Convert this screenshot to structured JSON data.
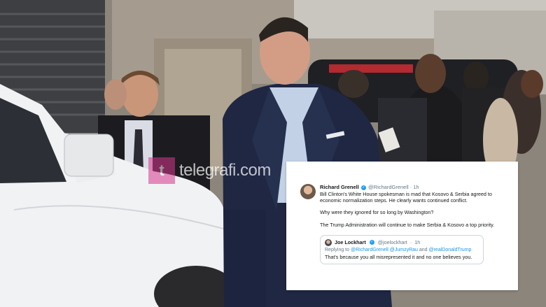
{
  "watermark": {
    "logo_glyph": "t",
    "site": "telegrafi.com"
  },
  "tweet": {
    "author_name": "Richard Grenell",
    "author_handle": "@RichardGrenell",
    "separator": "·",
    "time": "1h",
    "paragraphs": [
      "Bill Clinton's White House spokesman is mad that Kosovo & Serbia agreed to economic normalization steps. He clearly wants continued conflict.",
      "Why were they ignored for so long by Washington?",
      "The Trump Administration will continue to make Serbia & Kosovo a top priority."
    ]
  },
  "quote": {
    "author_name": "Joe Lockhart",
    "author_handle": "@joelockhart",
    "time": "1h",
    "replying_prefix": "Replying to",
    "mentions": [
      "@RichardGrenell",
      "@JumzyRau",
      "@realDonaldTrump"
    ],
    "and_word": "and",
    "text": "That's because you all misrepresented it and no one believes you."
  },
  "colors": {
    "card_bg": "#ffffff",
    "link_blue": "#1b95e0",
    "verified_blue": "#1da1f2",
    "watermark_pink": "#d8368f"
  }
}
